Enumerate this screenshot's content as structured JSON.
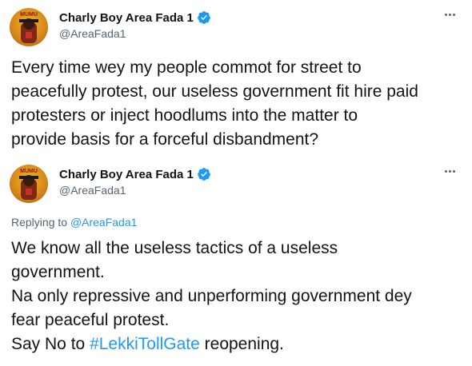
{
  "tweets": [
    {
      "display_name": "Charly Boy Area Fada 1",
      "handle": "@AreaFada1",
      "lines": [
        "Every time wey my people commot for street to",
        "peacefully protest, our useless government fit hire paid",
        "protesters or inject hoodlums into the matter to",
        "provide basis for a forceful disbandment?"
      ]
    },
    {
      "display_name": "Charly Boy Area Fada 1",
      "handle": "@AreaFada1",
      "replying_prefix": "Replying to ",
      "replying_handle": "@AreaFada1",
      "lines": [
        "We know all the useless tactics of a useless",
        "government.",
        "Na only repressive and unperforming government dey",
        "fear  peaceful protest."
      ],
      "last_line_prefix": "Say No to ",
      "hashtag": "#LekkiTollGate",
      "last_line_suffix": " reopening."
    }
  ],
  "avatar_text": "MUMU",
  "colors": {
    "link": "#1d9bf0",
    "secondary_text": "#536471",
    "primary_text": "#0f1419"
  },
  "icons": {
    "verified": "verified-badge-icon",
    "more": "more-options-icon"
  }
}
